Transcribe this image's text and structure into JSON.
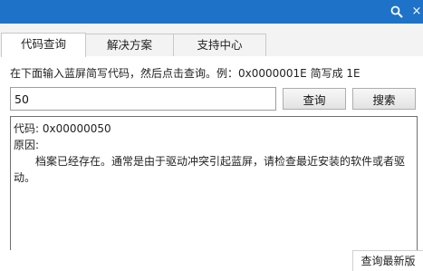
{
  "titlebar": {
    "accent_color": "#1e73c8",
    "search_icon": "search-icon",
    "close_icon": "close-icon",
    "close_glyph": "×"
  },
  "tabs": [
    {
      "label": "代码查询",
      "active": true
    },
    {
      "label": "解决方案",
      "active": false
    },
    {
      "label": "支持中心",
      "active": false
    }
  ],
  "query": {
    "instruction": "在下面输入蓝屏简写代码，然后点击查询。例：0x0000001E 简写成 1E",
    "input_value": "50",
    "query_button": "查询",
    "search_button": "搜索"
  },
  "result": {
    "code_line": "代码: 0x00000050",
    "reason_label": "原因:",
    "reason_text": "档案已经存在。通常是由于驱动冲突引起蓝屏，请检查最近安装的软件或者驱动。"
  },
  "status": {
    "check_update": "查询最新版"
  }
}
